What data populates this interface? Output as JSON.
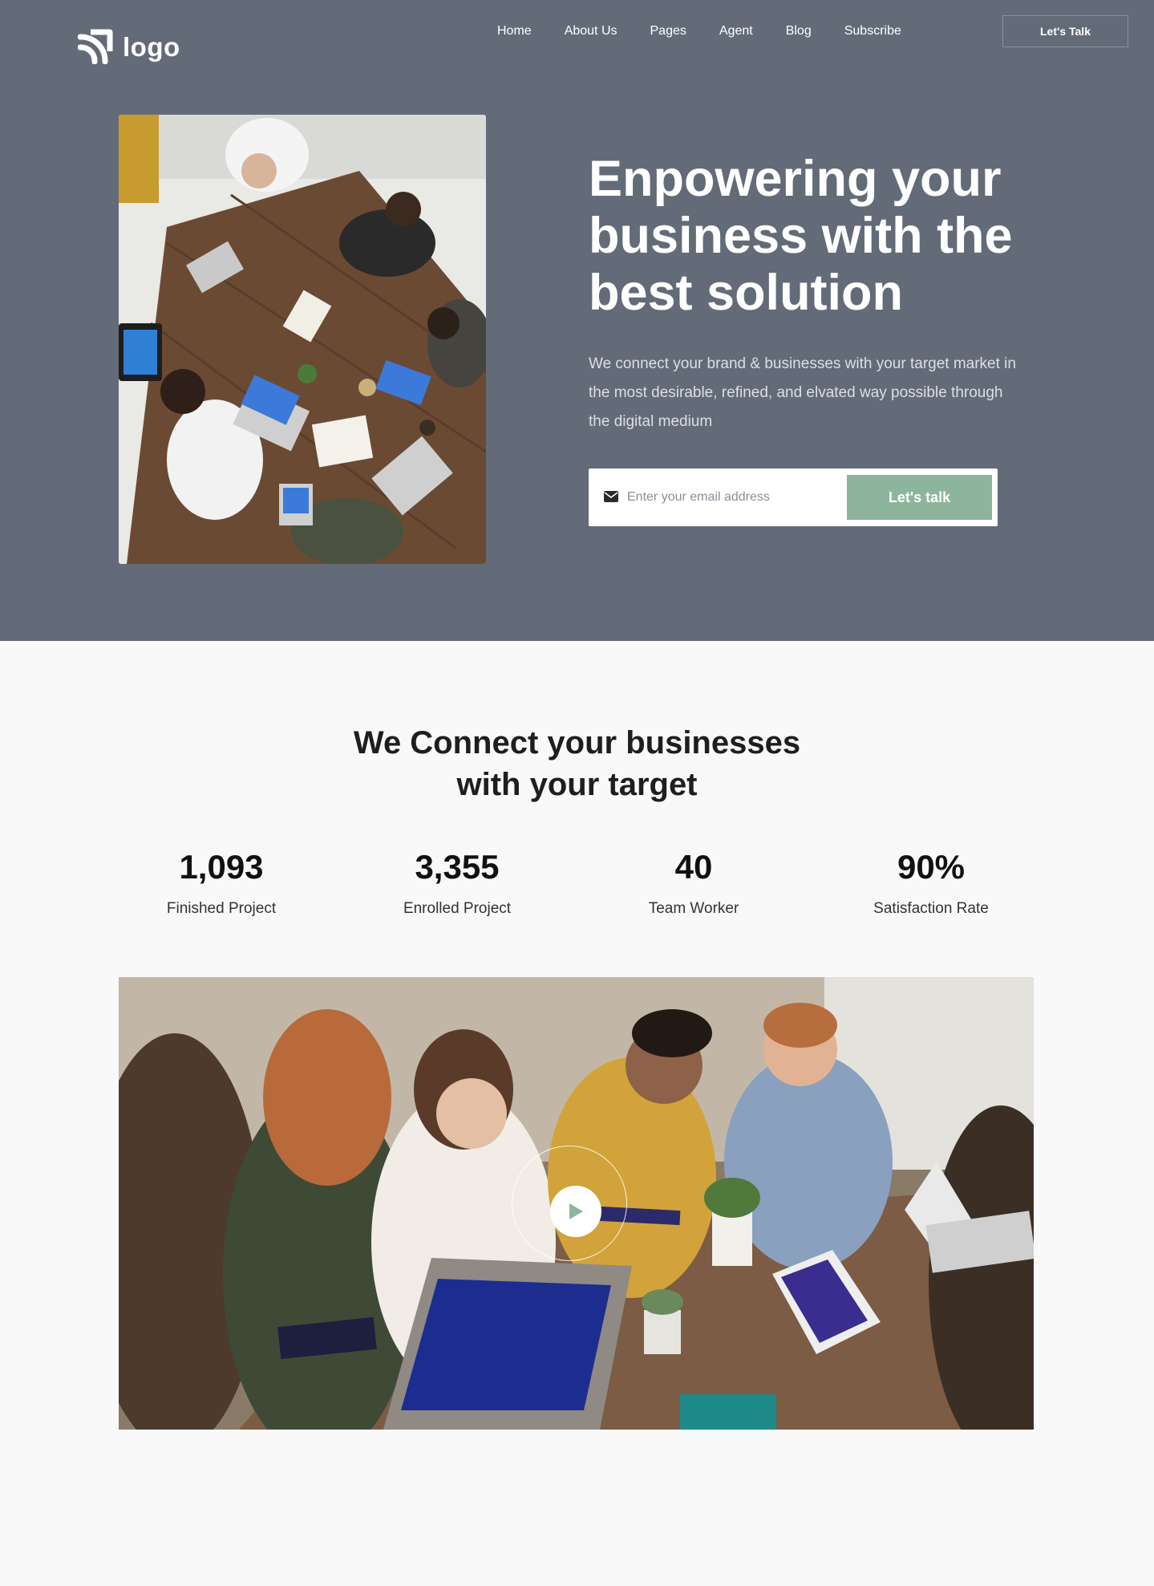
{
  "header": {
    "logo_text": "logo",
    "nav": [
      "Home",
      "About Us",
      "Pages",
      "Agent",
      "Blog",
      "Subscribe"
    ],
    "cta_label": "Let's Talk"
  },
  "hero": {
    "title": "Enpowering your business with the best solution",
    "description": "We connect your brand & businesses with your target market in the most desirable, refined, and elvated way possible through the digital medium",
    "email_placeholder": "Enter your email address",
    "submit_label": "Let's talk",
    "mail_icon": "envelope-icon"
  },
  "stats_section": {
    "title": "We Connect your businesses with your target",
    "stats": [
      {
        "value": "1,093",
        "label": "Finished Project"
      },
      {
        "value": "3,355",
        "label": "Enrolled Project"
      },
      {
        "value": "40",
        "label": "Team Worker"
      },
      {
        "value": "90%",
        "label": "Satisfaction Rate"
      }
    ]
  },
  "video": {
    "play_icon": "play-icon"
  },
  "colors": {
    "hero_bg": "#636b79",
    "accent_green": "#8db59b",
    "page_bg": "#f9f9f9"
  }
}
